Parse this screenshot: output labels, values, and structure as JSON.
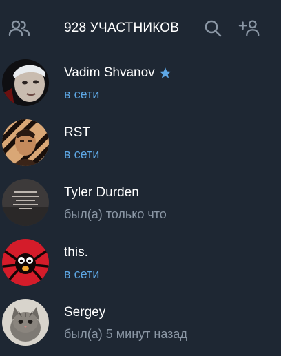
{
  "header": {
    "title": "928 УЧАСТНИКОВ",
    "icons": [
      "members-icon",
      "search-icon",
      "add-member-icon"
    ]
  },
  "colors": {
    "background": "#1e2733",
    "online": "#5ea8e6",
    "offline": "#8a96a4",
    "star": "#5ea8e6"
  },
  "members": [
    {
      "name": "Vadim Shvanov",
      "status": "в сети",
      "online": true,
      "starred": true
    },
    {
      "name": "RST",
      "status": "в сети",
      "online": true,
      "starred": false
    },
    {
      "name": "Tyler Durden",
      "status": "был(а) только что",
      "online": false,
      "starred": false
    },
    {
      "name": "this.",
      "status": "в сети",
      "online": true,
      "starred": false
    },
    {
      "name": "Sergey",
      "status": "был(а) 5 минут назад",
      "online": false,
      "starred": false
    }
  ]
}
